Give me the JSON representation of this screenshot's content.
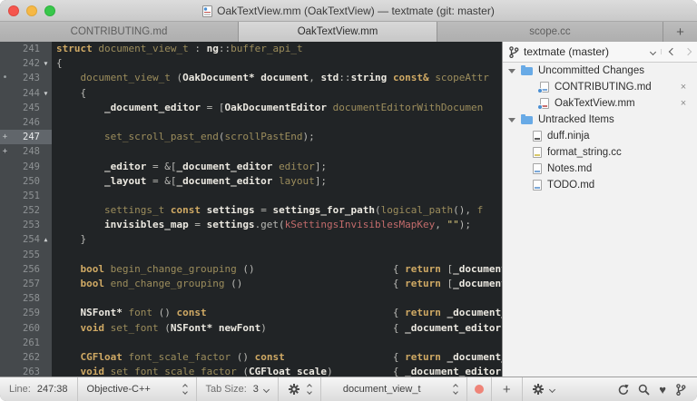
{
  "window": {
    "title": "OakTextView.mm (OakTextView) — textmate (git: master)"
  },
  "tabs": [
    {
      "label": "CONTRIBUTING.md",
      "active": false
    },
    {
      "label": "OakTextView.mm",
      "active": true
    },
    {
      "label": "scope.cc",
      "active": false
    }
  ],
  "tabbar": {
    "new_tab_label": "+"
  },
  "editor": {
    "background": "#212426",
    "gutter_background": "#45494c",
    "current_line": 247,
    "lines": [
      {
        "num": 241,
        "tokens": [
          [
            "k",
            "struct"
          ],
          [
            "p",
            " "
          ],
          [
            "f",
            "document_view_t"
          ],
          [
            "p",
            " : "
          ],
          [
            "t",
            "ng"
          ],
          [
            "p",
            "::"
          ],
          [
            "f",
            "buffer_api_t"
          ]
        ]
      },
      {
        "num": 242,
        "fold": "open",
        "tokens": [
          [
            "p",
            "{"
          ]
        ]
      },
      {
        "num": 243,
        "marker": "dot",
        "tokens": [
          [
            "p",
            "    "
          ],
          [
            "f",
            "document_view_t"
          ],
          [
            "p",
            " ("
          ],
          [
            "t",
            "OakDocument*"
          ],
          [
            "p",
            " "
          ],
          [
            "t",
            "document"
          ],
          [
            "p",
            ", "
          ],
          [
            "t",
            "std"
          ],
          [
            "p",
            "::"
          ],
          [
            "t",
            "string"
          ],
          [
            "p",
            " "
          ],
          [
            "k",
            "const&"
          ],
          [
            "p",
            " "
          ],
          [
            "f",
            "scopeAttr"
          ]
        ]
      },
      {
        "num": 244,
        "fold": "open",
        "tokens": [
          [
            "p",
            "    {"
          ]
        ]
      },
      {
        "num": 245,
        "tokens": [
          [
            "p",
            "        "
          ],
          [
            "t",
            "_document_editor"
          ],
          [
            "p",
            " = ["
          ],
          [
            "t",
            "OakDocumentEditor"
          ],
          [
            "p",
            " "
          ],
          [
            "f",
            "documentEditorWithDocumen"
          ]
        ]
      },
      {
        "num": 246,
        "tokens": []
      },
      {
        "num": 247,
        "marker": "plus",
        "current": true,
        "tokens": [
          [
            "p",
            "        "
          ],
          [
            "f",
            "set_scroll_past_end"
          ],
          [
            "p",
            "("
          ],
          [
            "f",
            "scrollPastEnd"
          ],
          [
            "p",
            ");"
          ]
        ]
      },
      {
        "num": 248,
        "marker": "plus",
        "tokens": []
      },
      {
        "num": 249,
        "tokens": [
          [
            "p",
            "        "
          ],
          [
            "t",
            "_editor"
          ],
          [
            "p",
            " = &["
          ],
          [
            "t",
            "_document_editor"
          ],
          [
            "p",
            " "
          ],
          [
            "f",
            "editor"
          ],
          [
            "p",
            "];"
          ]
        ]
      },
      {
        "num": 250,
        "tokens": [
          [
            "p",
            "        "
          ],
          [
            "t",
            "_layout"
          ],
          [
            "p",
            " = &["
          ],
          [
            "t",
            "_document_editor"
          ],
          [
            "p",
            " "
          ],
          [
            "f",
            "layout"
          ],
          [
            "p",
            "];"
          ]
        ]
      },
      {
        "num": 251,
        "tokens": []
      },
      {
        "num": 252,
        "tokens": [
          [
            "p",
            "        "
          ],
          [
            "f",
            "settings_t"
          ],
          [
            "p",
            " "
          ],
          [
            "k",
            "const"
          ],
          [
            "p",
            " "
          ],
          [
            "t",
            "settings"
          ],
          [
            "p",
            " = "
          ],
          [
            "t",
            "settings_for_path"
          ],
          [
            "p",
            "("
          ],
          [
            "f",
            "logical_path"
          ],
          [
            "p",
            "(), "
          ],
          [
            "f",
            "f"
          ]
        ]
      },
      {
        "num": 253,
        "tokens": [
          [
            "p",
            "        "
          ],
          [
            "t",
            "invisibles_map"
          ],
          [
            "p",
            " = "
          ],
          [
            "t",
            "settings"
          ],
          [
            "p",
            ".get("
          ],
          [
            "c",
            "kSettingsInvisiblesMapKey"
          ],
          [
            "p",
            ", "
          ],
          [
            "s",
            "\"\""
          ],
          [
            "p",
            ");"
          ]
        ]
      },
      {
        "num": 254,
        "fold": "close",
        "tokens": [
          [
            "p",
            "    }"
          ]
        ]
      },
      {
        "num": 255,
        "tokens": []
      },
      {
        "num": 256,
        "tokens": [
          [
            "p",
            "    "
          ],
          [
            "k",
            "bool"
          ],
          [
            "p",
            " "
          ],
          [
            "f",
            "begin_change_grouping"
          ],
          [
            "p",
            " ()                       { "
          ],
          [
            "k",
            "return"
          ],
          [
            "p",
            " ["
          ],
          [
            "t",
            "_document_"
          ]
        ]
      },
      {
        "num": 257,
        "tokens": [
          [
            "p",
            "    "
          ],
          [
            "k",
            "bool"
          ],
          [
            "p",
            " "
          ],
          [
            "f",
            "end_change_grouping"
          ],
          [
            "p",
            " ()                         { "
          ],
          [
            "k",
            "return"
          ],
          [
            "p",
            " ["
          ],
          [
            "t",
            "_document_"
          ]
        ]
      },
      {
        "num": 258,
        "tokens": []
      },
      {
        "num": 259,
        "tokens": [
          [
            "p",
            "    "
          ],
          [
            "t",
            "NSFont*"
          ],
          [
            "p",
            " "
          ],
          [
            "f",
            "font"
          ],
          [
            "p",
            " () "
          ],
          [
            "k",
            "const"
          ],
          [
            "p",
            "                               { "
          ],
          [
            "k",
            "return"
          ],
          [
            "p",
            " "
          ],
          [
            "t",
            "_document_e"
          ]
        ]
      },
      {
        "num": 260,
        "tokens": [
          [
            "p",
            "    "
          ],
          [
            "k",
            "void"
          ],
          [
            "p",
            " "
          ],
          [
            "f",
            "set_font"
          ],
          [
            "p",
            " ("
          ],
          [
            "t",
            "NSFont*"
          ],
          [
            "p",
            " "
          ],
          [
            "t",
            "newFont"
          ],
          [
            "p",
            ")                     { "
          ],
          [
            "t",
            "_document_editor"
          ],
          [
            "p",
            ".f"
          ]
        ]
      },
      {
        "num": 261,
        "tokens": []
      },
      {
        "num": 262,
        "tokens": [
          [
            "p",
            "    "
          ],
          [
            "k",
            "CGFloat"
          ],
          [
            "p",
            " "
          ],
          [
            "f",
            "font_scale_factor"
          ],
          [
            "p",
            " () "
          ],
          [
            "k",
            "const"
          ],
          [
            "p",
            "                  { "
          ],
          [
            "k",
            "return"
          ],
          [
            "p",
            " "
          ],
          [
            "t",
            "_document_e"
          ]
        ]
      },
      {
        "num": 263,
        "tokens": [
          [
            "p",
            "    "
          ],
          [
            "k",
            "void"
          ],
          [
            "p",
            " "
          ],
          [
            "f",
            "set_font_scale_factor"
          ],
          [
            "p",
            " ("
          ],
          [
            "t",
            "CGFloat"
          ],
          [
            "p",
            " "
          ],
          [
            "t",
            "scale"
          ],
          [
            "p",
            ")          { "
          ],
          [
            "t",
            "_document_editor"
          ]
        ]
      }
    ]
  },
  "sidebar": {
    "branch_label": "textmate (master)",
    "sections": [
      {
        "label": "Uncommitted Changes",
        "items": [
          {
            "name": "CONTRIBUTING.md",
            "badge": true,
            "closable": true,
            "close_label": "×",
            "bar_color": "#7aa7d8"
          },
          {
            "name": "OakTextView.mm",
            "badge": true,
            "closable": true,
            "close_label": "×",
            "bar_color": "#c86f6f"
          }
        ]
      },
      {
        "label": "Untracked Items",
        "items": [
          {
            "name": "duff.ninja",
            "bar_color": "#5a5a5a"
          },
          {
            "name": "format_string.cc",
            "bar_color": "#d8c86a"
          },
          {
            "name": "Notes.md",
            "bar_color": "#7aa7d8"
          },
          {
            "name": "TODO.md",
            "bar_color": "#7aa7d8"
          }
        ]
      }
    ]
  },
  "statusbar": {
    "line_label": "Line:",
    "line_value": "247:38",
    "language": "Objective-C++",
    "tab_size_label": "Tab Size:",
    "tab_size_value": "3",
    "symbol": "document_view_t",
    "plus_label": "+",
    "bookmark_color": "#ef8478",
    "icons": [
      "refresh-icon",
      "search-icon",
      "heart-icon",
      "branch-icon"
    ]
  }
}
